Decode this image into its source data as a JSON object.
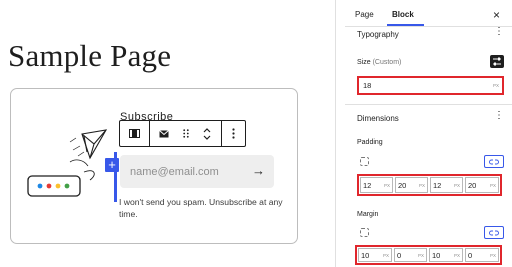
{
  "editor": {
    "page_title": "Sample Page",
    "hidden_heading": "Subscribe",
    "email_placeholder": "name@email.com",
    "submit_arrow": "→",
    "spam_note": "I won't send you spam. Unsubscribe at any time.",
    "inserter": "+"
  },
  "toolbar": {
    "icons": [
      "block-type-icon",
      "mail-icon",
      "drag-handle-icon",
      "move-up-down-icon",
      "more-options-icon"
    ]
  },
  "sidebar": {
    "tabs": [
      "Page",
      "Block"
    ],
    "active_tab": "Block",
    "close": "×",
    "typography": {
      "title": "Typography",
      "size_label": "Size",
      "size_sub": "(Custom)",
      "size_value": "18",
      "size_unit": "PX"
    },
    "dimensions": {
      "title": "Dimensions",
      "padding_label": "Padding",
      "padding": [
        {
          "value": "12",
          "unit": "PX"
        },
        {
          "value": "20",
          "unit": "PX"
        },
        {
          "value": "12",
          "unit": "PX"
        },
        {
          "value": "20",
          "unit": "PX"
        }
      ],
      "margin_label": "Margin",
      "margin": [
        {
          "value": "10",
          "unit": "PX"
        },
        {
          "value": "0",
          "unit": "PX"
        },
        {
          "value": "10",
          "unit": "PX"
        },
        {
          "value": "0",
          "unit": "PX"
        }
      ]
    }
  },
  "colors": {
    "accent": "#3858e9",
    "highlight": "#e0262c"
  }
}
